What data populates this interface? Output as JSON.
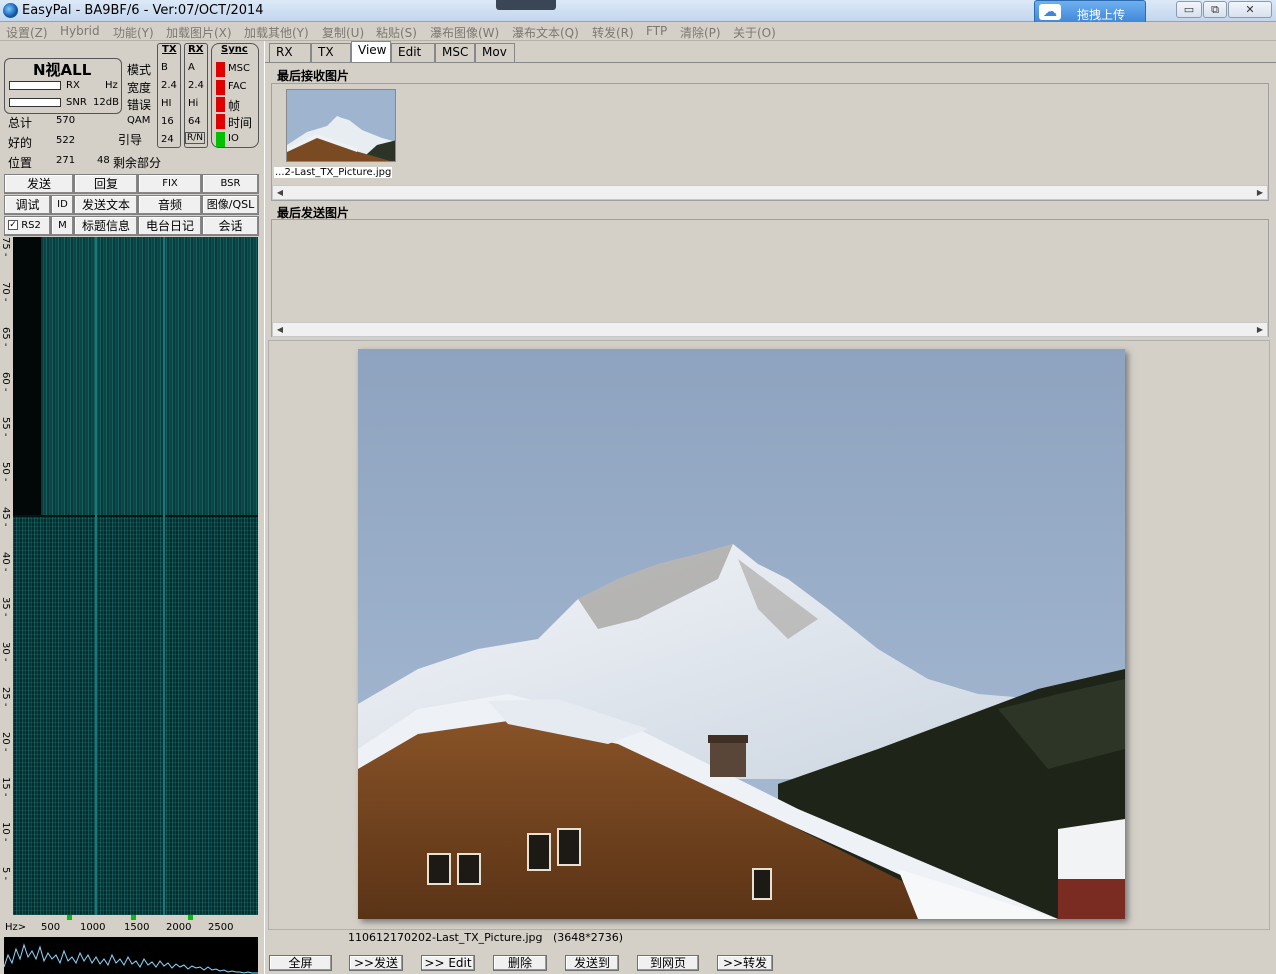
{
  "window": {
    "title": "EasyPal - BA9BF/6 - Ver:07/OCT/2014",
    "upload_label": "拖拽上传",
    "upload_icon": "cloud-icon",
    "min": "▭",
    "max": "⧉",
    "close": "✕"
  },
  "menu": [
    "设置(Z)",
    "Hybrid",
    "功能(Y)",
    "加载图片(X)",
    "加载其他(Y)",
    "复制(U)",
    "粘贴(S)",
    "瀑布图像(W)",
    "瀑布文本(Q)",
    "转发(R)",
    "FTP",
    "清除(P)",
    "关于(O)"
  ],
  "status": {
    "callsign": "N视ALL",
    "rx": "RX",
    "hz": "Hz",
    "snr_label": "SNR",
    "snr_value": "12dB",
    "labels": [
      "模式",
      "宽度",
      "错误",
      "QAM",
      "引导"
    ],
    "total_label": "总计",
    "total": "570",
    "good_label": "好的",
    "good": "522",
    "pos_label": "位置",
    "pos": "271",
    "remain": "48",
    "remain_label": "剩余部分"
  },
  "tx": {
    "header": "TX",
    "values": [
      "B",
      "2.4",
      "HI",
      "16",
      "24"
    ]
  },
  "rx": {
    "header": "RX",
    "values": [
      "A",
      "2.4",
      "Hi",
      "64",
      "R/N"
    ]
  },
  "sync": {
    "header": "Sync",
    "items": [
      "MSC",
      "FAC",
      "帧",
      "时间",
      "IO"
    ]
  },
  "buttons": {
    "row1": [
      "发送",
      "回复",
      "FIX",
      "BSR"
    ],
    "row2": [
      "调试",
      "ID",
      "发送文本",
      "音频",
      "图像/QSL"
    ],
    "row3": [
      "RS2",
      "M",
      "标题信息",
      "电台日记",
      "会话"
    ]
  },
  "waterfall": {
    "ticks": [
      "75",
      "70",
      "65",
      "60",
      "55",
      "50",
      "45",
      "40",
      "35",
      "30",
      "25",
      "20",
      "15",
      "10",
      "5"
    ]
  },
  "freq": {
    "prefix": "Hz>",
    "ticks": [
      "500",
      "1000",
      "1500",
      "2000",
      "2500"
    ]
  },
  "tabs": [
    "RX",
    "TX",
    "View",
    "Edit",
    "MSC",
    "Mov"
  ],
  "active_tab": "View",
  "received": {
    "title": "最后接收图片",
    "thumb_caption": "...2-Last_TX_Picture.jpg"
  },
  "sent": {
    "title": "最后发送图片"
  },
  "viewer": {
    "filename": "110612170202-Last_TX_Picture.jpg",
    "dims": "(3648*2736)"
  },
  "bottom_buttons": [
    "全屏",
    ">>发送",
    ">> Edit",
    "删除",
    "发送到",
    "到网页",
    ">>转发"
  ]
}
